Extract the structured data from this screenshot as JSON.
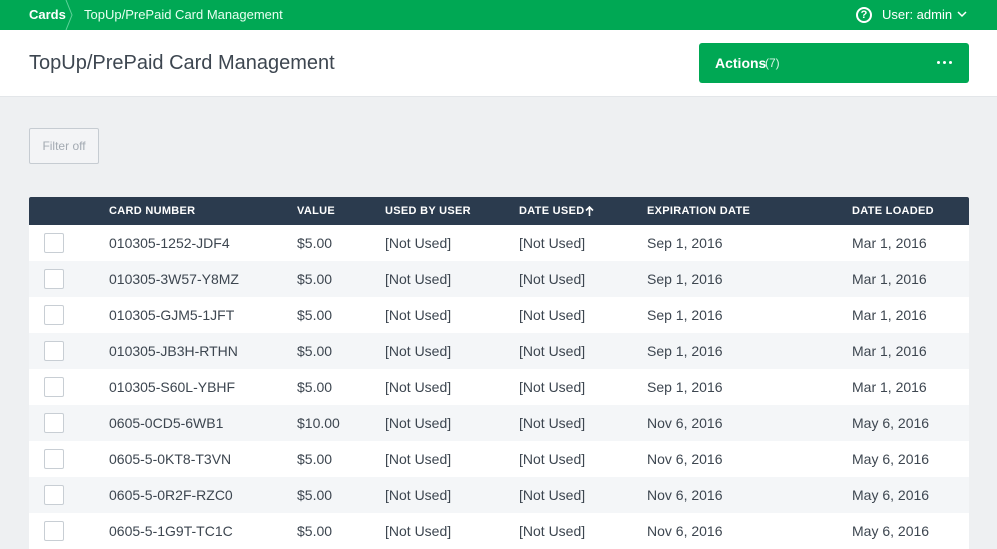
{
  "breadcrumb": {
    "root": "Cards",
    "current": "TopUp/PrePaid Card Management"
  },
  "help_icon_glyph": "?",
  "user_menu": {
    "label": "User: admin"
  },
  "header": {
    "title": "TopUp/PrePaid Card Management",
    "actions": {
      "label": "Actions",
      "count": "(7)"
    }
  },
  "filter": {
    "label": "Filter off"
  },
  "table": {
    "columns": {
      "card_number": "CARD NUMBER",
      "value": "VALUE",
      "used_by_user": "USED BY USER",
      "date_used": "DATE USED",
      "expiration_date": "EXPIRATION DATE",
      "date_loaded": "DATE LOADED"
    },
    "sort": {
      "column": "date_used",
      "direction": "ascending"
    },
    "rows": [
      {
        "card_number": "010305-1252-JDF4",
        "value": "$5.00",
        "used_by": "[Not Used]",
        "date_used": "[Not Used]",
        "expiration": "Sep 1, 2016",
        "loaded": "Mar 1, 2016"
      },
      {
        "card_number": "010305-3W57-Y8MZ",
        "value": "$5.00",
        "used_by": "[Not Used]",
        "date_used": "[Not Used]",
        "expiration": "Sep 1, 2016",
        "loaded": "Mar 1, 2016"
      },
      {
        "card_number": "010305-GJM5-1JFT",
        "value": "$5.00",
        "used_by": "[Not Used]",
        "date_used": "[Not Used]",
        "expiration": "Sep 1, 2016",
        "loaded": "Mar 1, 2016"
      },
      {
        "card_number": "010305-JB3H-RTHN",
        "value": "$5.00",
        "used_by": "[Not Used]",
        "date_used": "[Not Used]",
        "expiration": "Sep 1, 2016",
        "loaded": "Mar 1, 2016"
      },
      {
        "card_number": "010305-S60L-YBHF",
        "value": "$5.00",
        "used_by": "[Not Used]",
        "date_used": "[Not Used]",
        "expiration": "Sep 1, 2016",
        "loaded": "Mar 1, 2016"
      },
      {
        "card_number": "0605-0CD5-6WB1",
        "value": "$10.00",
        "used_by": "[Not Used]",
        "date_used": "[Not Used]",
        "expiration": "Nov 6, 2016",
        "loaded": "May 6, 2016"
      },
      {
        "card_number": "0605-5-0KT8-T3VN",
        "value": "$5.00",
        "used_by": "[Not Used]",
        "date_used": "[Not Used]",
        "expiration": "Nov 6, 2016",
        "loaded": "May 6, 2016"
      },
      {
        "card_number": "0605-5-0R2F-RZC0",
        "value": "$5.00",
        "used_by": "[Not Used]",
        "date_used": "[Not Used]",
        "expiration": "Nov 6, 2016",
        "loaded": "May 6, 2016"
      },
      {
        "card_number": "0605-5-1G9T-TC1C",
        "value": "$5.00",
        "used_by": "[Not Used]",
        "date_used": "[Not Used]",
        "expiration": "Nov 6, 2016",
        "loaded": "May 6, 2016"
      }
    ]
  },
  "colors": {
    "brand_green": "#00a854",
    "table_header": "#2b3b4e",
    "page_bg": "#eef0f2"
  }
}
